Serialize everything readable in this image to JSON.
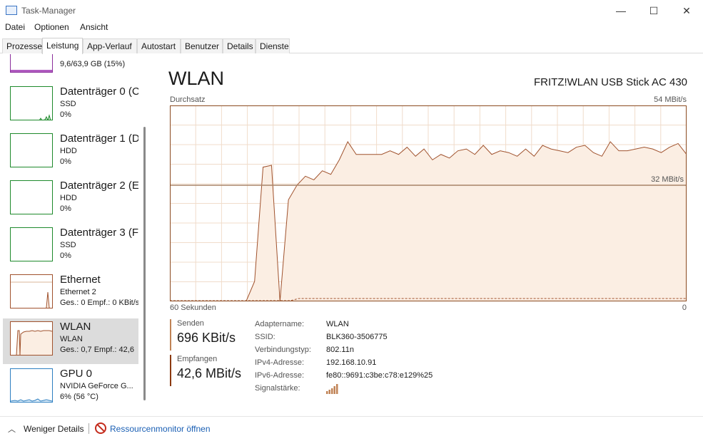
{
  "window": {
    "title": "Task-Manager",
    "minimize": "—",
    "maximize": "☐",
    "close": "✕"
  },
  "menu": [
    "Datei",
    "Optionen",
    "Ansicht"
  ],
  "tabs": [
    "Prozesse",
    "Leistung",
    "App-Verlauf",
    "Autostart",
    "Benutzer",
    "Details",
    "Dienste"
  ],
  "sidebar": {
    "top_cut_text": "9,6/63,9 GB (15%)",
    "items": [
      {
        "name": "Datenträger 0 (C",
        "sub": "SSD",
        "value": "0%"
      },
      {
        "name": "Datenträger 1 (D",
        "sub": "HDD",
        "value": "0%"
      },
      {
        "name": "Datenträger 2 (E",
        "sub": "HDD",
        "value": "0%"
      },
      {
        "name": "Datenträger 3 (F",
        "sub": "SSD",
        "value": "0%"
      },
      {
        "name": "Ethernet",
        "sub": "Ethernet 2",
        "value": "Ges.: 0 Empf.: 0 KBit/s"
      },
      {
        "name": "WLAN",
        "sub": "WLAN",
        "value": "Ges.: 0,7 Empf.: 42,6"
      },
      {
        "name": "GPU 0",
        "sub": "NVIDIA GeForce G...",
        "value": "6% (56 °C)"
      }
    ]
  },
  "main": {
    "title": "WLAN",
    "adapter": "FRITZ!WLAN USB Stick AC 430",
    "throughput_label": "Durchsatz",
    "max_label": "54 MBit/s",
    "mid_label": "32 MBit/s",
    "seconds_label": "60 Sekunden",
    "zero_label": "0"
  },
  "stats": {
    "send_label": "Senden",
    "send_value": "696 KBit/s",
    "recv_label": "Empfangen",
    "recv_value": "42,6 MBit/s"
  },
  "properties": [
    {
      "key": "Adaptername:",
      "value": "WLAN"
    },
    {
      "key": "SSID:",
      "value": "BLK360-3506775"
    },
    {
      "key": "Verbindungstyp:",
      "value": "802.11n"
    },
    {
      "key": "IPv4-Adresse:",
      "value": "192.168.10.91"
    },
    {
      "key": "IPv6-Adresse:",
      "value": "fe80::9691:c3be:c78:e129%25"
    },
    {
      "key": "Signalstärke:",
      "value": ""
    }
  ],
  "footer": {
    "fewer_details": "Weniger Details",
    "resmon": "Ressourcenmonitor öffnen"
  },
  "colors": {
    "wlan_line": "#a0522d",
    "wlan_fill": "#fbeee3",
    "grid": "#f0dccb",
    "disk": "#1e8a2c",
    "gpu": "#2d7fc1"
  },
  "chart_data": {
    "type": "area",
    "title": "Durchsatz",
    "xlabel": "60 Sekunden",
    "ylabel": "",
    "xlim": [
      60,
      0
    ],
    "ylim": [
      0,
      54
    ],
    "grid": true,
    "reference_line": 32,
    "series": [
      {
        "name": "Empfangen",
        "values": [
          0,
          0,
          0,
          0,
          0,
          0,
          0,
          0,
          0,
          0,
          0,
          0,
          0,
          0,
          0,
          0,
          0,
          0,
          0,
          0,
          0,
          0,
          0,
          0,
          0,
          0,
          0,
          0,
          0,
          0,
          0,
          0,
          0,
          0,
          0,
          0,
          0,
          0,
          0,
          0,
          0,
          0,
          0,
          0,
          0,
          0,
          0,
          0,
          0,
          0,
          0,
          0,
          0,
          0,
          0,
          0,
          0,
          0,
          0,
          0,
          0
        ]
      },
      {
        "name": "Senden",
        "values": [
          0,
          0,
          0,
          0,
          0,
          0,
          0,
          0,
          0,
          0,
          5.5,
          37,
          37.5,
          0,
          28,
          32,
          34.5,
          33.5,
          36,
          35,
          39,
          44,
          40.5,
          40.5,
          40.5,
          40.5,
          41.5,
          40.5,
          42.5,
          40,
          42,
          39,
          40.5,
          39.5,
          41.5,
          42,
          40.5,
          43,
          40.5,
          41.5,
          41,
          40,
          42,
          40,
          43,
          42,
          41.5,
          41,
          42.5,
          43,
          41,
          40,
          44,
          41.5,
          41.5,
          42,
          42.5,
          42,
          41,
          42.5,
          43.5,
          40.5
        ]
      }
    ]
  }
}
